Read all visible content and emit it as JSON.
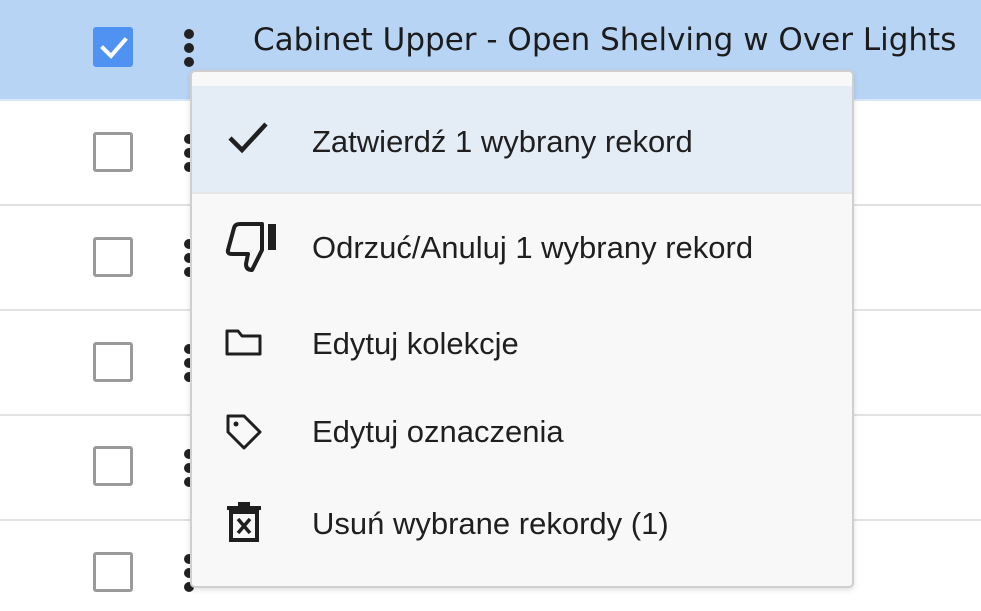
{
  "rows": [
    {
      "title": "Cabinet Upper - Open Shelving w Over Lights",
      "checked": true
    },
    {
      "title": "",
      "checked": false
    },
    {
      "title": "",
      "checked": false
    },
    {
      "title": "",
      "checked": false
    },
    {
      "title": "",
      "checked": false
    },
    {
      "title": "",
      "checked": false
    }
  ],
  "menu": {
    "items": [
      {
        "label": "Zatwierdź 1 wybrany rekord",
        "icon": "check-icon"
      },
      {
        "label": "Odrzuć/Anuluj 1 wybrany rekord",
        "icon": "thumbs-down-icon"
      },
      {
        "label": "Edytuj kolekcje",
        "icon": "folder-icon"
      },
      {
        "label": "Edytuj oznaczenia",
        "icon": "tag-icon"
      },
      {
        "label": "Usuń wybrane rekordy (1)",
        "icon": "trash-icon"
      }
    ]
  },
  "colors": {
    "selected_row": "#b8d4f5",
    "checkbox_checked": "#4f92f2",
    "menu_highlight": "#e4ecf6"
  }
}
